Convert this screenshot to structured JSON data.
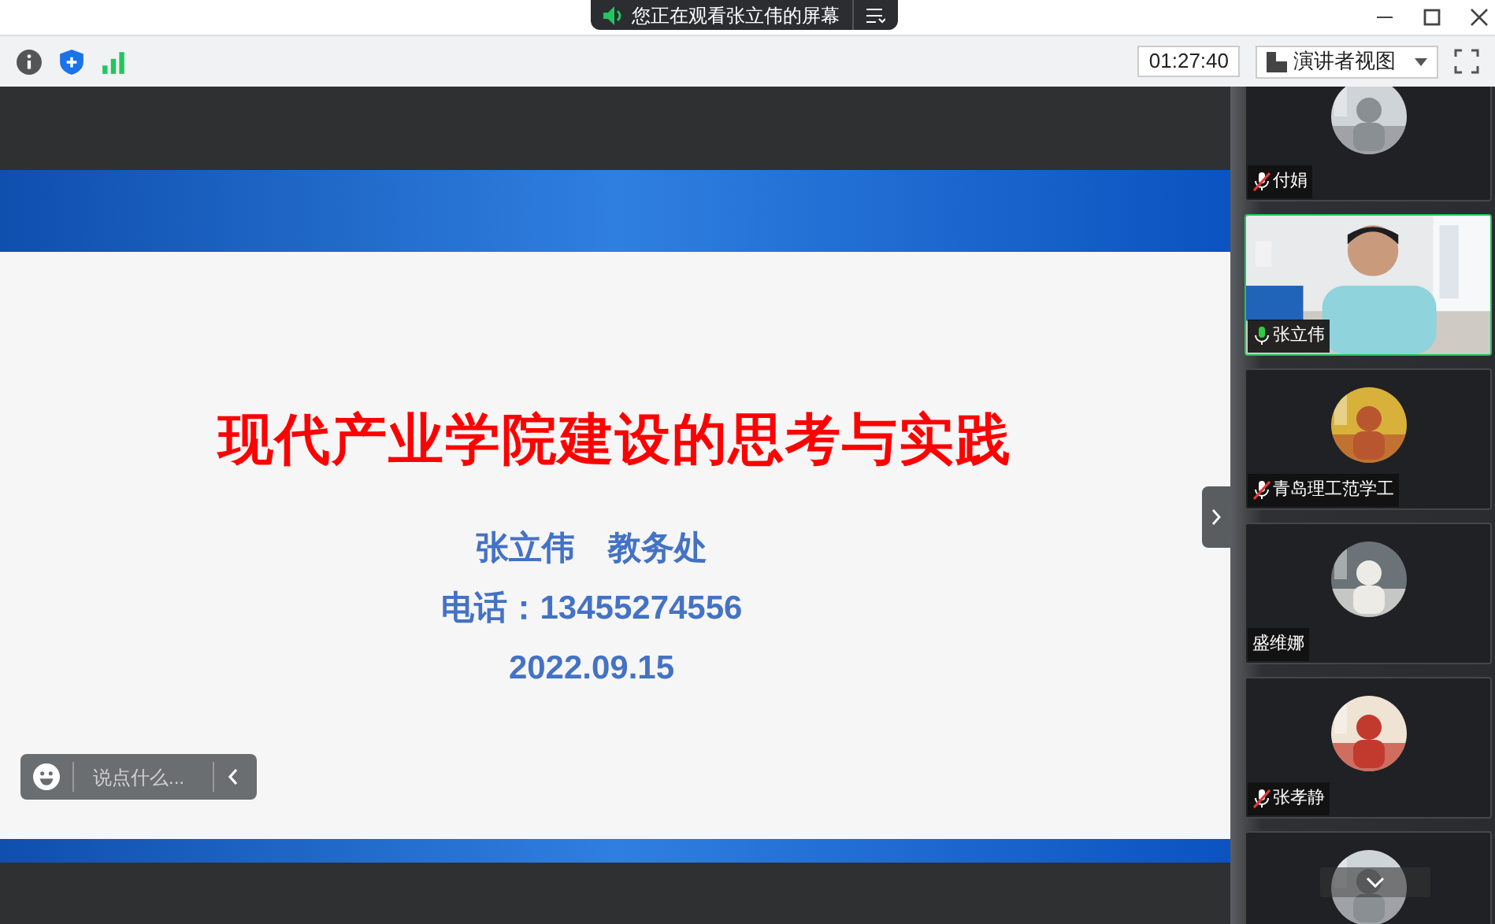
{
  "banner": {
    "text": "您正在观看张立伟的屏幕"
  },
  "toolbar": {
    "timer": "01:27:40",
    "view_button": "演讲者视图"
  },
  "slide": {
    "title": "现代产业学院建设的思考与实践",
    "lines": [
      "张立伟　教务处",
      "电话：13455274556",
      "2022.09.15"
    ]
  },
  "chat": {
    "placeholder": "说点什么..."
  },
  "participants": [
    {
      "name": "付娟",
      "kind": "avatar",
      "muted": true,
      "selected": false
    },
    {
      "name": "张立伟",
      "kind": "video",
      "muted": false,
      "selected": true
    },
    {
      "name": "青岛理工范学工",
      "kind": "avatar",
      "muted": true,
      "selected": false
    },
    {
      "name": "盛维娜",
      "kind": "avatar",
      "selected": false
    },
    {
      "name": "张孝静",
      "kind": "avatar",
      "muted": true,
      "selected": false
    },
    {
      "kind": "avatar",
      "selected": false
    }
  ]
}
